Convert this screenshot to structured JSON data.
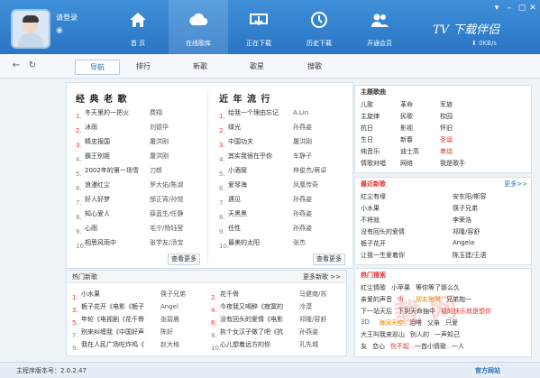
{
  "user": {
    "login_text": "请登录"
  },
  "nav": [
    {
      "label": "首 页",
      "icon": "home-icon"
    },
    {
      "label": "在线歌库",
      "icon": "cloud-icon"
    },
    {
      "label": "正在下载",
      "icon": "download-tray-icon"
    },
    {
      "label": "历史下载",
      "icon": "history-icon"
    },
    {
      "label": "开通会员",
      "icon": "member-icon"
    }
  ],
  "brand": {
    "name": "TV 下载伴侣",
    "speed": "0KB/s"
  },
  "tabs": [
    "导航",
    "排行",
    "新歌",
    "歌星",
    "搜歌"
  ],
  "classic": {
    "title": "经 典 老 歌",
    "more": "查看更多",
    "songs": [
      {
        "n": "1.",
        "t": "冬天里的一把火",
        "a": "费翔"
      },
      {
        "n": "2.",
        "t": "冰雨",
        "a": "刘德华"
      },
      {
        "n": "3.",
        "t": "精忠报国",
        "a": "屠洪刚"
      },
      {
        "n": "4.",
        "t": "霸王别姬",
        "a": "屠洪刚"
      },
      {
        "n": "5.",
        "t": "2002年的第一场雪",
        "a": "刀郎"
      },
      {
        "n": "6.",
        "t": "浪漫红尘",
        "a": "罗大佑/陈淑"
      },
      {
        "n": "7.",
        "t": "好人好梦",
        "a": "邰正宵/孙悦"
      },
      {
        "n": "8.",
        "t": "知心爱人",
        "a": "薛蓝生/任静"
      },
      {
        "n": "9.",
        "t": "心雨",
        "a": "毛宁/杨钰莹"
      },
      {
        "n": "10.",
        "t": "相思风雨中",
        "a": "张学友/汤宝"
      }
    ]
  },
  "recent": {
    "title": "近 年 流 行",
    "more": "查看更多",
    "songs": [
      {
        "n": "1.",
        "t": "给我一个理由忘记",
        "a": "A.Lin"
      },
      {
        "n": "2.",
        "t": "绿光",
        "a": "孙燕姿"
      },
      {
        "n": "3.",
        "t": "中国功夫",
        "a": "屠洪刚"
      },
      {
        "n": "4.",
        "t": "其实我很在乎你",
        "a": "车静子"
      },
      {
        "n": "5.",
        "t": "小酒窝",
        "a": "林俊杰/蔡卓"
      },
      {
        "n": "6.",
        "t": "爱琴海",
        "a": "凤凰传奇"
      },
      {
        "n": "7.",
        "t": "遇见",
        "a": "孙燕姿"
      },
      {
        "n": "8.",
        "t": "天黑黑",
        "a": "孙燕姿"
      },
      {
        "n": "9.",
        "t": "任性",
        "a": "孙燕姿"
      },
      {
        "n": "10.",
        "t": "最美的太阳",
        "a": "张杰"
      }
    ]
  },
  "hot_new": {
    "title": "热门新歌",
    "more": "更多新歌 >>",
    "left": [
      {
        "n": "1.",
        "t": "小水果",
        "a": "筷子兄弟"
      },
      {
        "n": "3.",
        "t": "栀子花开《电影《栀子",
        "a": "Angel"
      },
      {
        "n": "5.",
        "t": "年轮《电视剧《花千骨",
        "a": "张碧晨"
      },
      {
        "n": "7.",
        "t": "别来纠缠我《中国好声",
        "a": "陈好"
      },
      {
        "n": "9.",
        "t": "我在人民广场吃炸鸡《",
        "a": "赵大格"
      }
    ],
    "right": [
      {
        "n": "2.",
        "t": "花千骨",
        "a": "马健南/苏"
      },
      {
        "n": "4.",
        "t": "今夜我又喝醉《寂寞的",
        "a": "冷漠"
      },
      {
        "n": "6.",
        "t": "没有回头的爱情《电影",
        "a": "祁隆/容舒"
      },
      {
        "n": "8.",
        "t": "执个女汉子做了吧《抗",
        "a": "孙燕姿"
      },
      {
        "n": "10.",
        "t": "心儿想着远方的你",
        "a": "孔先城"
      }
    ]
  },
  "theme": {
    "title": "主题歌曲",
    "tags": [
      {
        "t": "儿歌",
        "c": ""
      },
      {
        "t": "革命",
        "c": ""
      },
      {
        "t": "军旅",
        "c": ""
      },
      {
        "t": "主旋律",
        "c": ""
      },
      {
        "t": "民歌",
        "c": ""
      },
      {
        "t": "校园",
        "c": ""
      },
      {
        "t": "抗日",
        "c": ""
      },
      {
        "t": "影视",
        "c": ""
      },
      {
        "t": "怀旧",
        "c": ""
      },
      {
        "t": "生日",
        "c": ""
      },
      {
        "t": "新春",
        "c": ""
      },
      {
        "t": "圣诞",
        "c": "red"
      },
      {
        "t": "纯音乐",
        "c": ""
      },
      {
        "t": "迪士高",
        "c": ""
      },
      {
        "t": "串烧",
        "c": "red"
      },
      {
        "t": "情歌对唱",
        "c": ""
      },
      {
        "t": "网络",
        "c": ""
      },
      {
        "t": "我是歌手",
        "c": ""
      }
    ]
  },
  "latest": {
    "title": "最近新歌",
    "more": "更多>>",
    "rows": [
      [
        "红尘有缘",
        "安东阳/斯容"
      ],
      [
        "小水果",
        "筷子兄弟"
      ],
      [
        "不将就",
        "李荣浩"
      ],
      [
        "没有回头的爱情",
        "祁隆/容舒"
      ],
      [
        "栀子花开",
        "Angela"
      ],
      [
        "让我一生爱着你",
        "陈玉建/王语"
      ]
    ]
  },
  "hot_search": {
    "title": "热门搜索",
    "lines": [
      [
        {
          "t": "红尘情歌",
          "c": ""
        },
        {
          "t": "小苹果",
          "c": ""
        },
        {
          "t": "等你等了那么久",
          "c": ""
        }
      ],
      [
        {
          "t": "亲爱的声音",
          "c": ""
        },
        {
          "t": "dj",
          "c": "red"
        },
        {
          "t": "朋友别哭",
          "c": "orange"
        },
        {
          "t": "兄弟抱一",
          "c": ""
        }
      ],
      [
        {
          "t": "下一站天后",
          "c": ""
        },
        {
          "t": "下到天命抽中",
          "c": ""
        },
        {
          "t": "我的快乐就是想你",
          "c": "red"
        }
      ],
      [
        {
          "t": "3D",
          "c": "blue"
        },
        {
          "t": "海阔天空",
          "c": "orange"
        },
        {
          "t": "泪嗒",
          "c": ""
        },
        {
          "t": "父亲",
          "c": ""
        },
        {
          "t": "只爱",
          "c": ""
        }
      ],
      [
        {
          "t": "大王叫我来巡山",
          "c": ""
        },
        {
          "t": "别人的",
          "c": ""
        },
        {
          "t": "一声知己",
          "c": ""
        }
      ],
      [
        {
          "t": "友",
          "c": ""
        },
        {
          "t": "恋心",
          "c": ""
        },
        {
          "t": "伤不起",
          "c": "red"
        },
        {
          "t": "一首小情歌",
          "c": ""
        },
        {
          "t": "一人",
          "c": ""
        }
      ]
    ]
  },
  "status": {
    "version": "主程序版本号：2.0.2.47",
    "site": "官方网站"
  },
  "watermark": {
    "big": "载 网",
    "small": "www.pc6.com"
  }
}
